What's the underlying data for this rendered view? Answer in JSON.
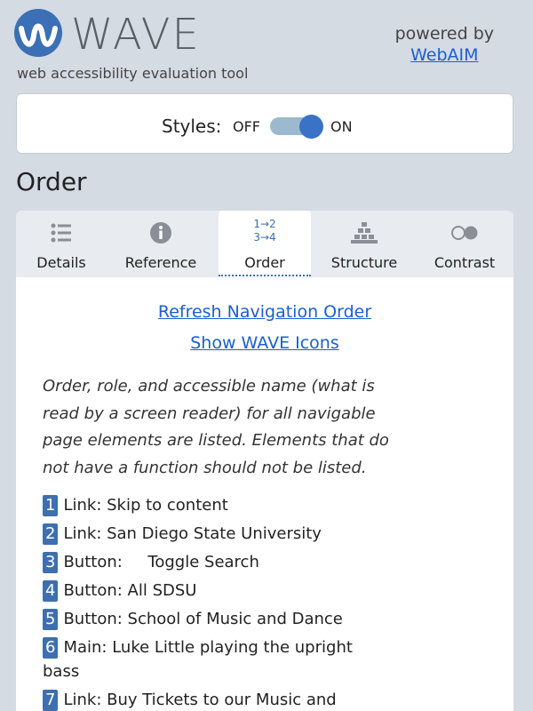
{
  "header": {
    "logo_text": "WAVE",
    "tagline": "web accessibility evaluation tool",
    "powered_by": "powered by",
    "webaim_link": "WebAIM"
  },
  "styles_toggle": {
    "label": "Styles:",
    "off": "OFF",
    "on": "ON",
    "state": "on"
  },
  "section_title": "Order",
  "tabs": [
    {
      "label": "Details",
      "icon": "list-icon"
    },
    {
      "label": "Reference",
      "icon": "info-icon"
    },
    {
      "label": "Order",
      "icon": "order-icon",
      "icon_top": "1→2",
      "icon_bottom": "3→4",
      "active": true
    },
    {
      "label": "Structure",
      "icon": "structure-icon"
    },
    {
      "label": "Contrast",
      "icon": "contrast-icon"
    }
  ],
  "links": {
    "refresh": "Refresh Navigation Order",
    "show_icons": "Show WAVE Icons"
  },
  "description": "Order, role, and accessible name (what is read by a screen reader) for all navigable page elements are listed. Elements that do not have a function should not be listed.",
  "order_items": [
    {
      "num": "1",
      "text": "Link: Skip to content"
    },
    {
      "num": "2",
      "text": "Link: San Diego State University"
    },
    {
      "num": "3",
      "text": "Button:     Toggle Search"
    },
    {
      "num": "4",
      "text": "Button: All SDSU"
    },
    {
      "num": "5",
      "text": "Button: School of Music and Dance"
    },
    {
      "num": "6",
      "text": "Main: Luke Little playing the upright bass"
    },
    {
      "num": "7",
      "text": "Link: Buy Tickets to our Music and"
    }
  ],
  "colors": {
    "accent": "#3b6fb6",
    "link": "#1b5fd0",
    "background": "#d5dbe3"
  }
}
